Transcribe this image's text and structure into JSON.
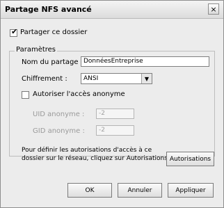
{
  "window": {
    "title": "Partage NFS avancé",
    "close_symbol": "×"
  },
  "share_folder": {
    "label": "Partager ce dossier",
    "checked": true
  },
  "parameters": {
    "group_label": "Paramètres",
    "share_name_label": "Nom du partage :",
    "share_name_value": "DonnéesEntreprise",
    "encryption_label": "Chiffrement :",
    "encryption_value": "ANSI",
    "anonymous_label": "Autoriser l'accès anonyme",
    "anonymous_checked": false,
    "uid_label": "UID anonyme :",
    "uid_value": "-2",
    "gid_label": "GID anonyme :",
    "gid_value": "-2",
    "permissions_text_line1": "Pour définir les autorisations d'accès à ce",
    "permissions_text_line2": "dossier sur le réseau, cliquez sur Autorisations.",
    "permissions_button": "Autorisations"
  },
  "footer": {
    "ok": "OK",
    "cancel": "Annuler",
    "apply": "Appliquer"
  }
}
